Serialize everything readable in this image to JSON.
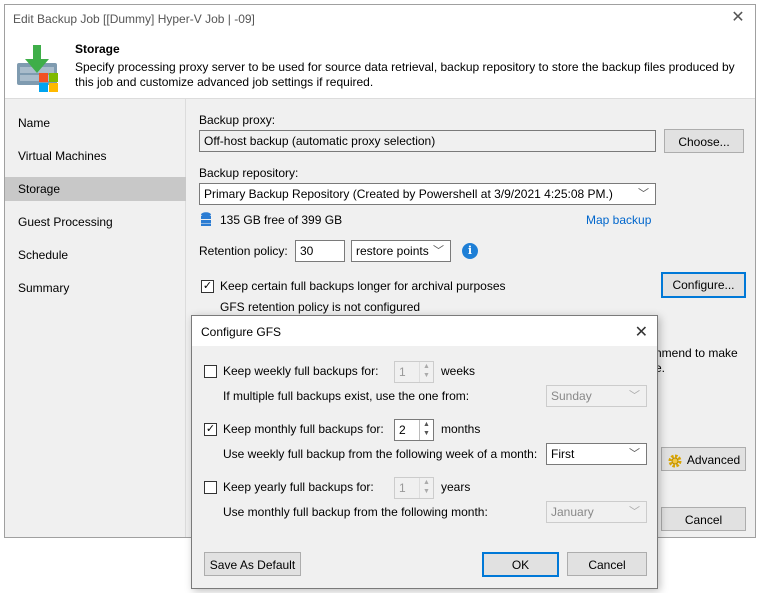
{
  "window": {
    "title": "Edit Backup Job [[Dummy] Hyper-V Job | -09]",
    "close_glyph": "✕"
  },
  "header": {
    "title": "Storage",
    "description": "Specify processing proxy server to be used for source data retrieval, backup repository to store the backup files produced by this job and customize advanced job settings if required.",
    "icon": "storage-download-icon"
  },
  "nav": {
    "items": [
      {
        "label": "Name",
        "selected": false
      },
      {
        "label": "Virtual Machines",
        "selected": false
      },
      {
        "label": "Storage",
        "selected": true
      },
      {
        "label": "Guest Processing",
        "selected": false
      },
      {
        "label": "Schedule",
        "selected": false
      },
      {
        "label": "Summary",
        "selected": false
      }
    ]
  },
  "storage": {
    "proxy_label": "Backup proxy:",
    "proxy_value": "Off-host backup (automatic proxy selection)",
    "choose_label": "Choose...",
    "repo_label": "Backup repository:",
    "repo_value": "Primary Backup Repository (Created by Powershell at 3/9/2021 4:25:08 PM.)",
    "repo_free": "135 GB free of 399 GB",
    "map_backup": "Map backup",
    "retention_label": "Retention policy:",
    "retention_value": "30",
    "retention_unit": "restore points",
    "keep_full_label": "Keep certain full backups longer for archival purposes",
    "keep_full_checked": true,
    "gfs_status": "GFS retention policy is not configured",
    "configure_label": "Configure...",
    "partial_text_1": "nmend to make",
    "partial_text_2": "e.",
    "advanced_label": "Advanced",
    "cancel_label": "Cancel"
  },
  "gfs_dialog": {
    "title": "Configure GFS",
    "close_glyph": "✕",
    "weekly_label": "Keep weekly full backups for:",
    "weekly_checked": false,
    "weekly_value": "1",
    "weekly_unit": "weeks",
    "weekly_sub_label": "If multiple full backups exist, use the one from:",
    "weekly_sub_value": "Sunday",
    "monthly_label": "Keep monthly full backups for:",
    "monthly_checked": true,
    "monthly_value": "2",
    "monthly_unit": "months",
    "monthly_sub_label": "Use weekly full backup from the following week of a month:",
    "monthly_sub_value": "First",
    "yearly_label": "Keep yearly full backups for:",
    "yearly_checked": false,
    "yearly_value": "1",
    "yearly_unit": "years",
    "yearly_sub_label": "Use monthly full backup from the following month:",
    "yearly_sub_value": "January",
    "save_default_label": "Save As Default",
    "ok_label": "OK",
    "cancel_label": "Cancel"
  }
}
